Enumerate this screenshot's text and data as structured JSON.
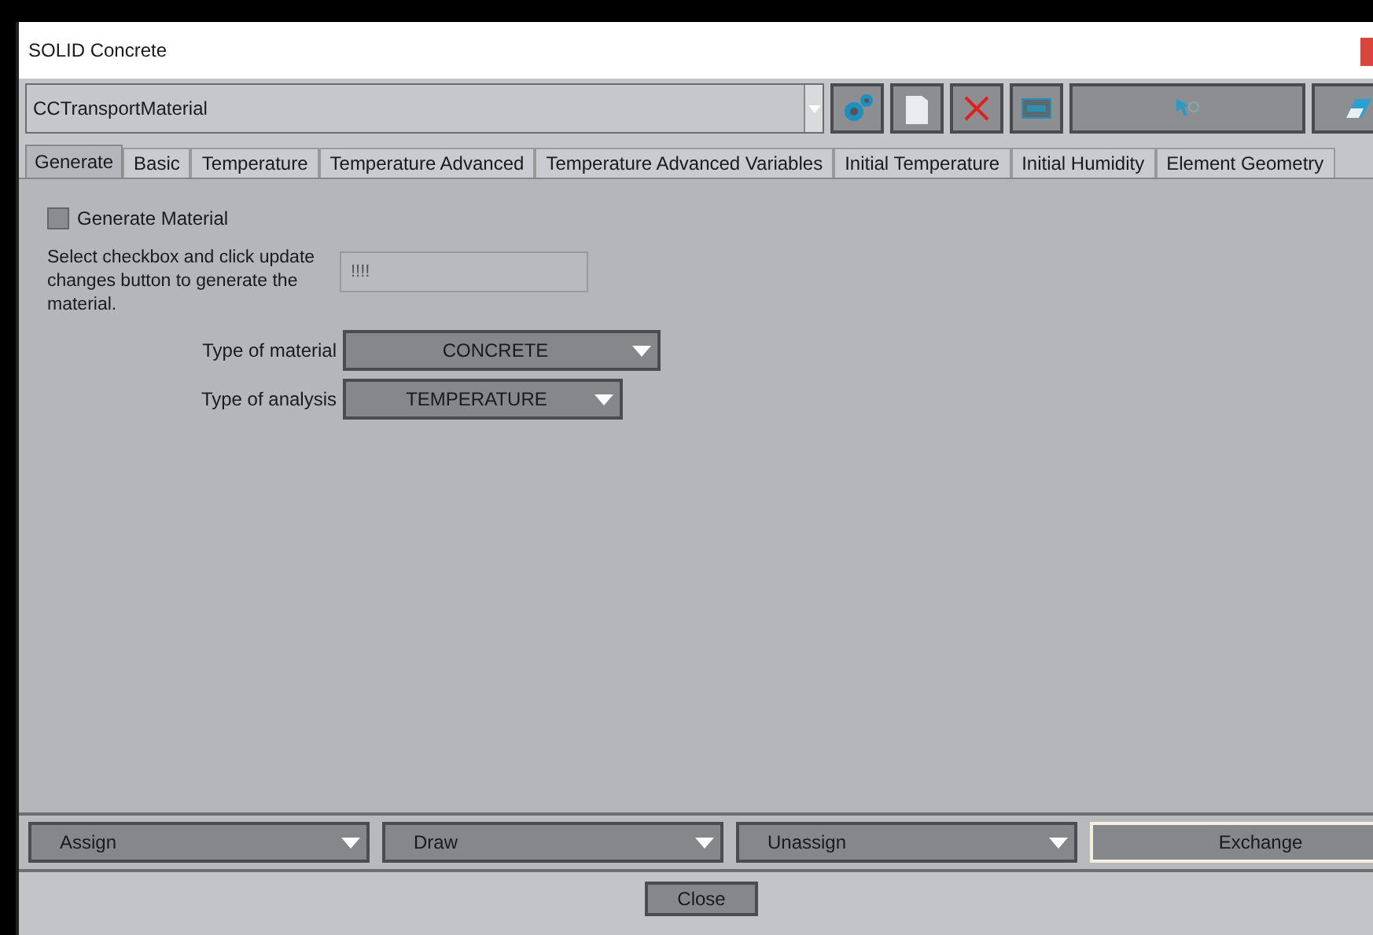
{
  "window": {
    "title": "SOLID Concrete"
  },
  "material_select": {
    "value": "CCTransportMaterial"
  },
  "toolbar": [
    {
      "kind": "gears"
    },
    {
      "kind": "page"
    },
    {
      "kind": "delete"
    },
    {
      "kind": "panel"
    },
    {
      "kind": "wide"
    },
    {
      "kind": "eraser"
    }
  ],
  "tabs": [
    {
      "label": "Generate",
      "selected": true
    },
    {
      "label": "Basic",
      "selected": false
    },
    {
      "label": "Temperature",
      "selected": false
    },
    {
      "label": "Temperature Advanced",
      "selected": false
    },
    {
      "label": "Temperature Advanced Variables",
      "selected": false
    },
    {
      "label": "Initial Temperature",
      "selected": false
    },
    {
      "label": "Initial Humidity",
      "selected": false
    },
    {
      "label": "Element Geometry",
      "selected": false
    }
  ],
  "generate_material": {
    "label": "Generate Material",
    "checked": false
  },
  "hint": "Select checkbox and click update changes button to generate the material.",
  "name_field": {
    "placeholder": "!!!!"
  },
  "dropdowns": [
    {
      "label": "Type of material",
      "value": "CONCRETE"
    },
    {
      "label": "Type of analysis",
      "value": "TEMPERATURE"
    }
  ],
  "bottom_buttons": [
    {
      "label": "Assign",
      "kind": "dropdown"
    },
    {
      "label": "Draw",
      "kind": "dropdown"
    },
    {
      "label": "Unassign",
      "kind": "dropdown"
    },
    {
      "label": "Exchange",
      "kind": "plain"
    }
  ],
  "close_button": "Close"
}
